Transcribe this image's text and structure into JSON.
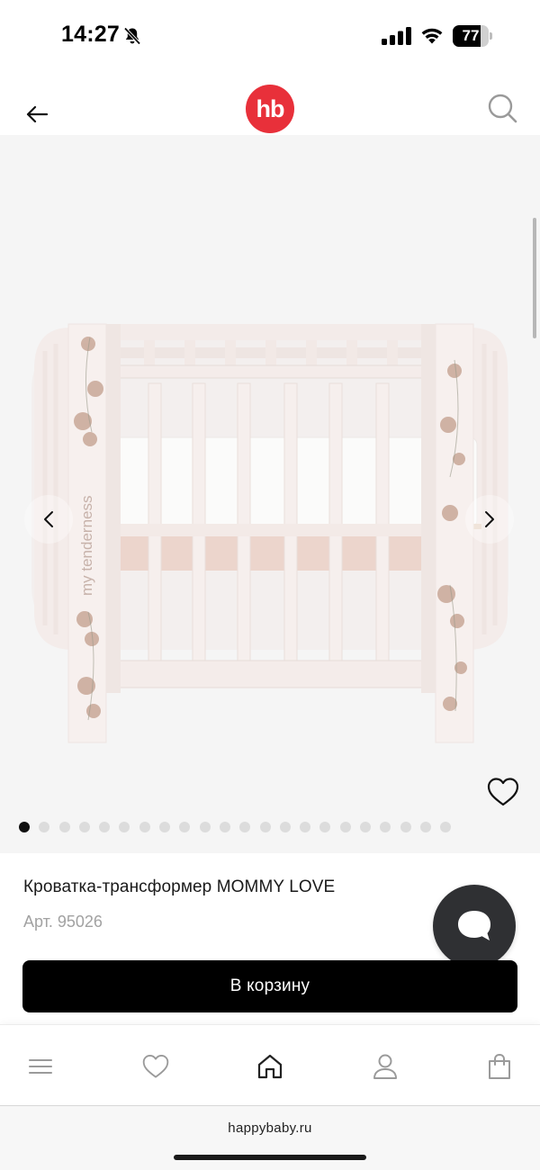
{
  "status_bar": {
    "time": "14:27",
    "battery": "77",
    "battery_level": 0.77,
    "icons": [
      "bell-slash-icon",
      "cellular-signal-icon",
      "wifi-icon",
      "battery-icon"
    ]
  },
  "header": {
    "logo_text": "hb",
    "logo_color": "#e8303a",
    "icons": [
      "arrow-left-icon",
      "search-icon"
    ]
  },
  "gallery": {
    "image_text": "my tenderness",
    "dots_count": 22,
    "active_index": 0,
    "icons": [
      "chevron-left-icon",
      "chevron-right-icon",
      "heart-outline-icon"
    ]
  },
  "product": {
    "title": "Кроватка-трансформер MOMMY LOVE",
    "sku": "Арт. 95026",
    "cart_button": "В корзину"
  },
  "chat": {
    "icon": "chat-bubble-icon",
    "color": "#2f3033"
  },
  "bottom_nav": {
    "items": [
      {
        "icon": "menu-icon"
      },
      {
        "icon": "heart-icon"
      },
      {
        "icon": "home-icon"
      },
      {
        "icon": "user-icon"
      },
      {
        "icon": "shopping-bag-icon"
      }
    ]
  },
  "browser": {
    "url": "happybaby.ru"
  }
}
